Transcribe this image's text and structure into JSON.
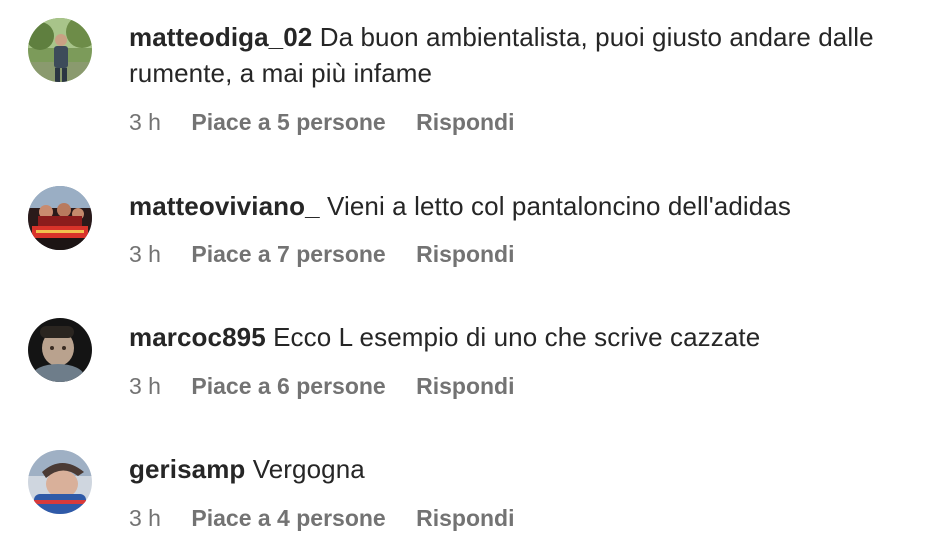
{
  "comments": [
    {
      "username": "matteodiga_02",
      "text": "Da buon ambientalista, puoi giusto andare dalle rumente, a mai più infame",
      "time": "3 h",
      "likes": "Piace a 5 persone",
      "reply": "Rispondi"
    },
    {
      "username": "matteoviviano_",
      "text": "Vieni a letto col pantaloncino dell'adidas",
      "time": "3 h",
      "likes": "Piace a 7 persone",
      "reply": "Rispondi"
    },
    {
      "username": "marcoc895",
      "text": "Ecco L esempio di uno che scrive cazzate",
      "time": "3 h",
      "likes": "Piace a 6 persone",
      "reply": "Rispondi"
    },
    {
      "username": "gerisamp",
      "text": "Vergogna",
      "time": "3 h",
      "likes": "Piace a 4 persone",
      "reply": "Rispondi"
    }
  ],
  "colors": {
    "text": "#262626",
    "secondary": "#737373",
    "background": "#ffffff"
  }
}
